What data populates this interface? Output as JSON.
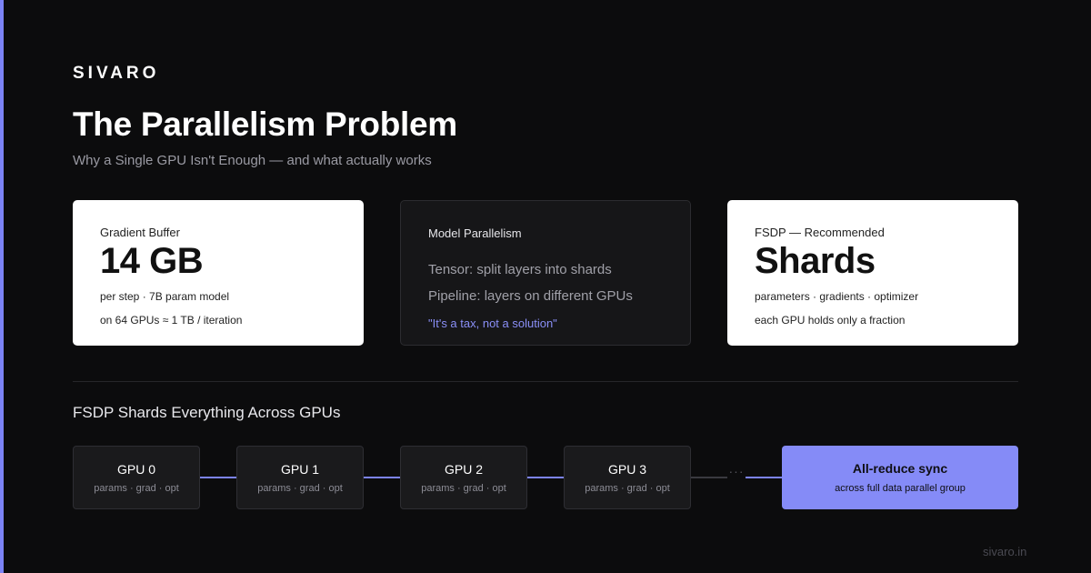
{
  "brand": "SIVARO",
  "title": "The Parallelism Problem",
  "subtitle": "Why a Single GPU Isn't Enough — and what actually works",
  "cards": {
    "gradient": {
      "label": "Gradient Buffer",
      "value": "14 GB",
      "line1": "per step · 7B param model",
      "line2": "on 64 GPUs ≈ 1 TB / iteration"
    },
    "model_parallelism": {
      "label": "Model Parallelism",
      "line1": "Tensor: split layers into shards",
      "line2": "Pipeline: layers on different GPUs",
      "quote": "\"It's a tax, not a solution\""
    },
    "fsdp": {
      "label": "FSDP — Recommended",
      "value": "Shards",
      "line1": "parameters · gradients · optimizer",
      "line2": "each GPU holds only a fraction"
    }
  },
  "section_title": "FSDP Shards Everything Across GPUs",
  "gpus": [
    {
      "name": "GPU 0",
      "sub": "params · grad · opt"
    },
    {
      "name": "GPU 1",
      "sub": "params · grad · opt"
    },
    {
      "name": "GPU 2",
      "sub": "params · grad · opt"
    },
    {
      "name": "GPU 3",
      "sub": "params · grad · opt"
    }
  ],
  "ellipsis": "···",
  "sync": {
    "title": "All-reduce sync",
    "sub": "across full data parallel group"
  },
  "footer_url": "sivaro.in",
  "colors": {
    "background": "#0c0c0d",
    "accent": "#7c83f5",
    "sync_box": "#858bf7",
    "card_light": "#ffffff",
    "card_dark": "#161618"
  }
}
